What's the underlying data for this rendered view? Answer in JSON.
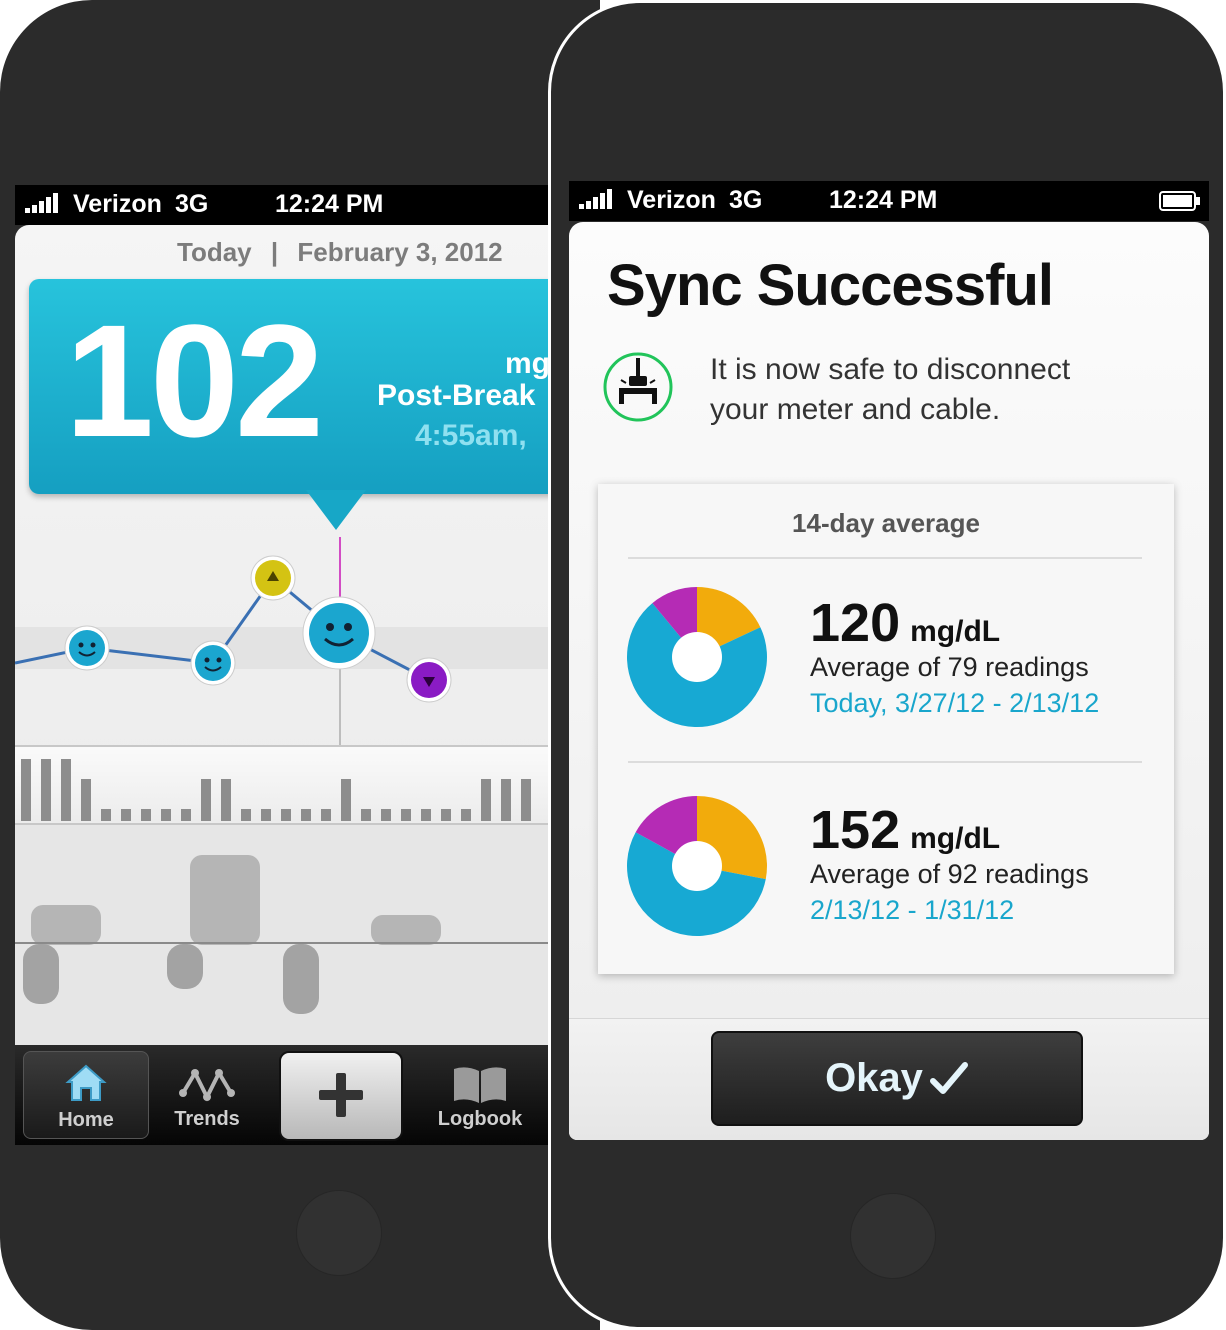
{
  "left_phone": {
    "status": {
      "carrier": "Verizon",
      "network": "3G",
      "time": "12:24 PM"
    },
    "date": {
      "day": "Today",
      "separator": "|",
      "full": "February 3, 2012"
    },
    "reading": {
      "value": "102",
      "unit": "mg",
      "meal": "Post-Break",
      "time": "4:55am,"
    },
    "tabs": [
      {
        "label": "Home",
        "icon": "home-icon"
      },
      {
        "label": "Trends",
        "icon": "trends-icon"
      },
      {
        "label": "",
        "icon": "plus-icon"
      },
      {
        "label": "Logbook",
        "icon": "book-icon"
      }
    ]
  },
  "right_phone": {
    "status": {
      "carrier": "Verizon",
      "network": "3G",
      "time": "12:24 PM"
    },
    "title": "Sync Successful",
    "message_line1": "It is now safe to disconnect",
    "message_line2": "your meter and cable.",
    "card": {
      "title": "14-day average",
      "items": [
        {
          "value": "120",
          "unit": "mg/dL",
          "count": "Average of 79 readings",
          "range": "Today, 3/27/12 - 2/13/12",
          "pie": {
            "in_range": 0.71,
            "high": 0.18,
            "low": 0.11
          }
        },
        {
          "value": "152",
          "unit": "mg/dL",
          "count": "Average of 92 readings",
          "range": "2/13/12 - 1/31/12",
          "pie": {
            "in_range": 0.55,
            "high": 0.28,
            "low": 0.17
          }
        }
      ]
    },
    "okay_label": "Okay",
    "colors": {
      "in_range": "#17a9d3",
      "high": "#f2ab0c",
      "low": "#b52bb5",
      "accent": "#1ca7cf"
    }
  }
}
